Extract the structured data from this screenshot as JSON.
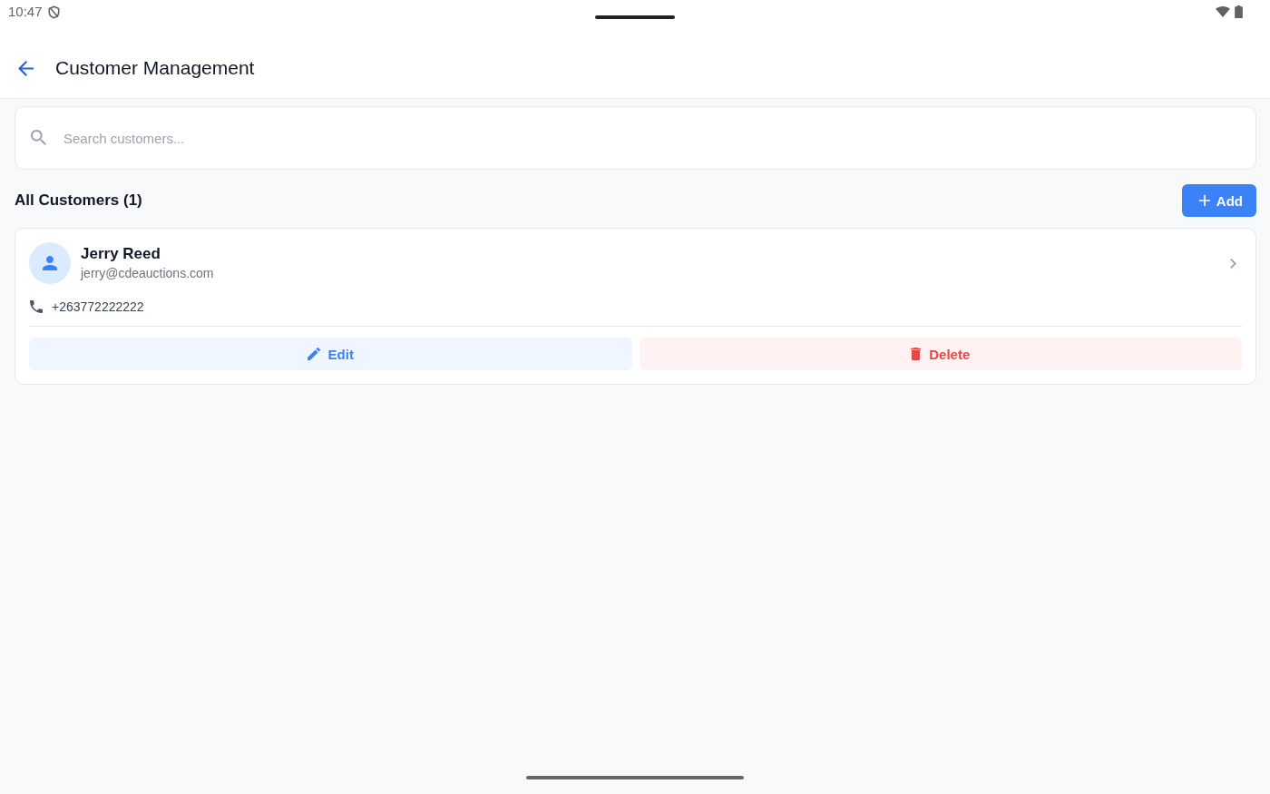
{
  "status_bar": {
    "time": "10:47"
  },
  "app_bar": {
    "title": "Customer Management"
  },
  "search": {
    "placeholder": "Search customers..."
  },
  "section": {
    "title": "All Customers (1)",
    "add_button": "Add"
  },
  "customers": [
    {
      "name": "Jerry Reed",
      "email": "jerry@cdeauctions.com",
      "phone": "+263772222222",
      "actions": [
        {
          "kind": "edit",
          "label": "Edit"
        },
        {
          "kind": "delete",
          "label": "Delete"
        }
      ]
    }
  ]
}
